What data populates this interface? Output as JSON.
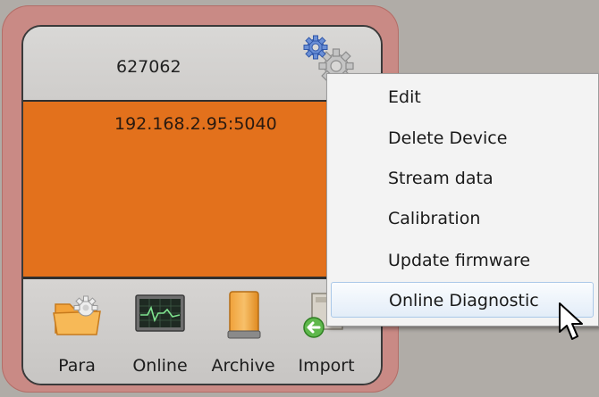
{
  "device": {
    "id": "627062",
    "address": "192.168.2.95:5040"
  },
  "toolbar": {
    "items": [
      {
        "label": "Para",
        "icon": "folder-gear-icon"
      },
      {
        "label": "Online",
        "icon": "monitor-icon"
      },
      {
        "label": "Archive",
        "icon": "archive-icon"
      },
      {
        "label": "Import",
        "icon": "import-icon"
      }
    ]
  },
  "context_menu": {
    "items": [
      {
        "label": "Edit"
      },
      {
        "label": "Delete Device"
      },
      {
        "label": "Stream data"
      },
      {
        "label": "Calibration"
      },
      {
        "label": "Update firmware"
      },
      {
        "label": "Online Diagnostic",
        "highlighted": true
      }
    ]
  },
  "colors": {
    "frame": "#c98a85",
    "status_body": "#e3711c",
    "menu_background": "#f3f3f3",
    "menu_highlight": "#e3edf8"
  }
}
